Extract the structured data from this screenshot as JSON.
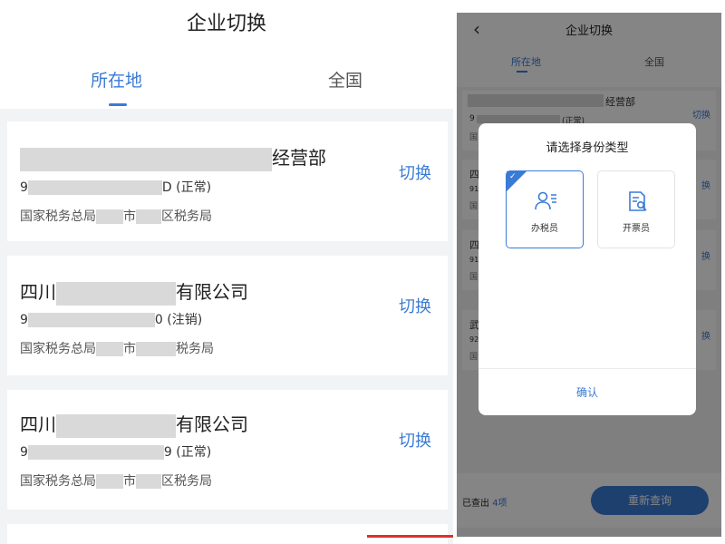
{
  "left": {
    "title": "企业切换",
    "tabs": [
      "所在地",
      "全国"
    ],
    "companies": [
      {
        "name_suffix": "经营部",
        "code_prefix": "9",
        "code_suffix": "D (正常)",
        "office_part1": "国家税务总局",
        "office_part2": "市",
        "office_part3": "区税务局",
        "switch_label": "切换"
      },
      {
        "name_prefix": "四川",
        "name_suffix": "有限公司",
        "code_prefix": "9",
        "code_suffix": "0 (注销)",
        "office_part1": "国家税务总局",
        "office_part2": "市",
        "office_part3": "税务局",
        "switch_label": "切换"
      },
      {
        "name_prefix": "四川",
        "name_suffix": "有限公司",
        "code_prefix": "9",
        "code_suffix": "9 (正常)",
        "office_part1": "国家税务总局",
        "office_part2": "市",
        "office_part3": "区税务局",
        "switch_label": "切换"
      }
    ]
  },
  "right": {
    "back_icon": "chevron-left-icon",
    "title": "企业切换",
    "tabs": [
      "所在地",
      "全国"
    ],
    "first_card": {
      "name_suffix": "经营部",
      "code_prefix": "9",
      "status": "(正常)",
      "office_prefix": "国",
      "switch_label": "切换"
    },
    "bg_cards": [
      {
        "name_prefix": "四",
        "code_prefix": "91",
        "office_prefix": "国",
        "switch_label": "换"
      },
      {
        "name_prefix": "四",
        "code_prefix": "91",
        "office_prefix": "国",
        "switch_label": "换"
      },
      {
        "name_prefix": "武",
        "code_prefix": "92",
        "office_prefix": "国",
        "switch_label": "换"
      }
    ],
    "footer": {
      "count_label": "已查出",
      "count_value": "4项",
      "requery_button": "重新查询"
    },
    "dialog": {
      "title": "请选择身份类型",
      "options": [
        {
          "label": "办税员",
          "icon": "tax-officer-icon",
          "selected": true
        },
        {
          "label": "开票员",
          "icon": "invoice-clerk-icon",
          "selected": false
        }
      ],
      "confirm": "确认"
    }
  },
  "colors": {
    "accent": "#3a7bd5",
    "mask": "#d9d9d9",
    "overlay": "rgba(0,0,0,0.48)"
  }
}
